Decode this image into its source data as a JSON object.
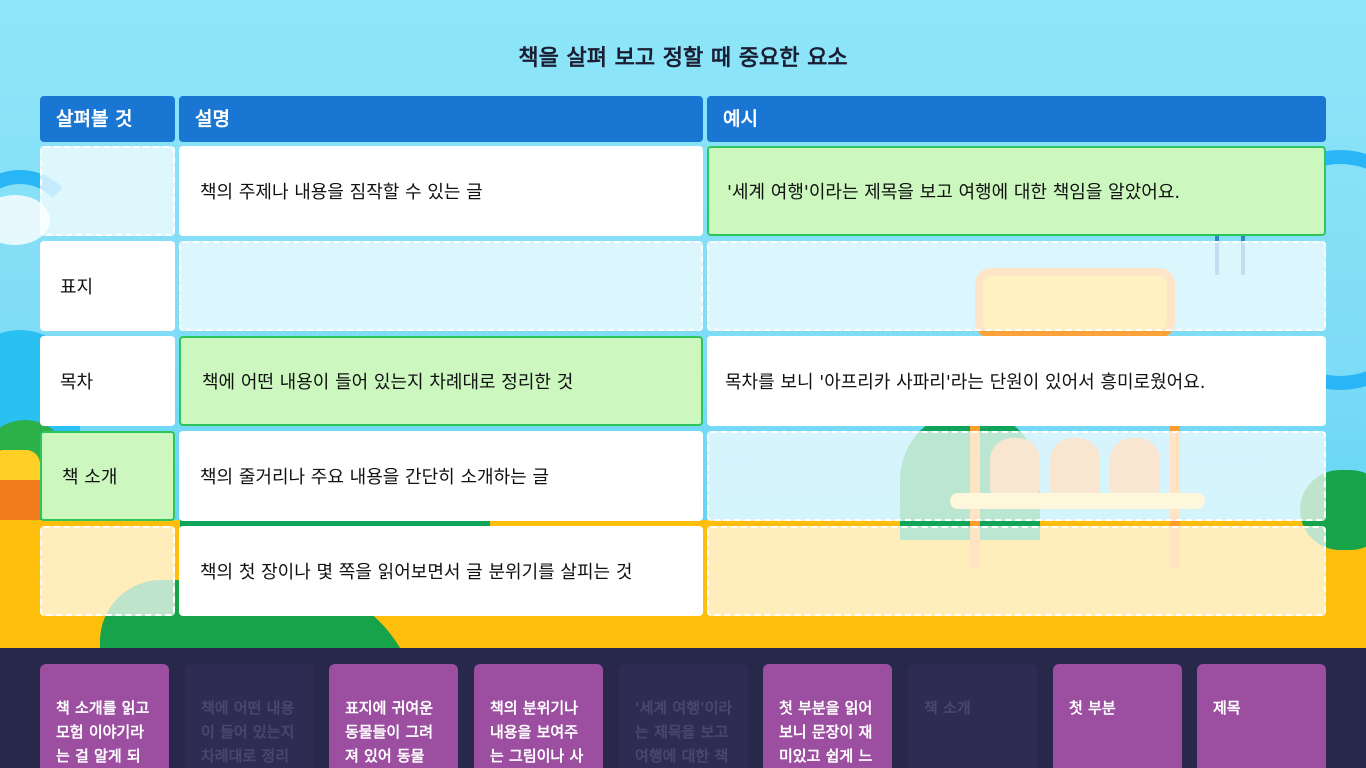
{
  "title": "책을 살펴 보고 정할 때 중요한 요소",
  "headers": {
    "col1": "살펴볼 것",
    "col2": "설명",
    "col3": "예시"
  },
  "rows": [
    {
      "item": "",
      "description": "책의 주제나 내용을 짐작할 수 있는 글",
      "example": "'세계 여행'이라는 제목을 보고 여행에 대한 책임을 알았어요."
    },
    {
      "item": "표지",
      "description": "",
      "example": ""
    },
    {
      "item": "목차",
      "description": "책에 어떤 내용이 들어 있는지 차례대로 정리한 것",
      "example": "목차를 보니 '아프리카 사파리'라는 단원이 있어서 흥미로웠어요."
    },
    {
      "item": "책 소개",
      "description": "책의 줄거리나 주요 내용을 간단히 소개하는 글",
      "example": ""
    },
    {
      "item": "",
      "description": "책의 첫 장이나 몇 쪽을 읽어보면서 글 분위기를 살피는 것",
      "example": ""
    }
  ],
  "cards": [
    {
      "text": "책 소개를 읽고 모험 이야기라는 걸 알게 되",
      "state": "available"
    },
    {
      "text": "책에 어떤 내용이 들어 있는지 차례대로 정리",
      "state": "used"
    },
    {
      "text": "표지에 귀여운 동물들이 그려져 있어 동물",
      "state": "available"
    },
    {
      "text": "책의 분위기나 내용을 보여주는 그림이나 사",
      "state": "available"
    },
    {
      "text": "'세계 여행'이라는 제목을 보고 여행에 대한 책",
      "state": "used"
    },
    {
      "text": "첫 부분을 읽어보니 문장이 재미있고 쉽게 느",
      "state": "available"
    },
    {
      "text": "책 소개",
      "state": "used"
    },
    {
      "text": "첫 부분",
      "state": "available"
    },
    {
      "text": "제목",
      "state": "available"
    }
  ],
  "colors": {
    "header_bg": "#1976d2",
    "correct_bg": "#ccf7be",
    "correct_border": "#2ec55a",
    "card_bg": "#9c4fa0",
    "card_used_bg": "#2f2b52",
    "tray_bg": "#27284a"
  }
}
